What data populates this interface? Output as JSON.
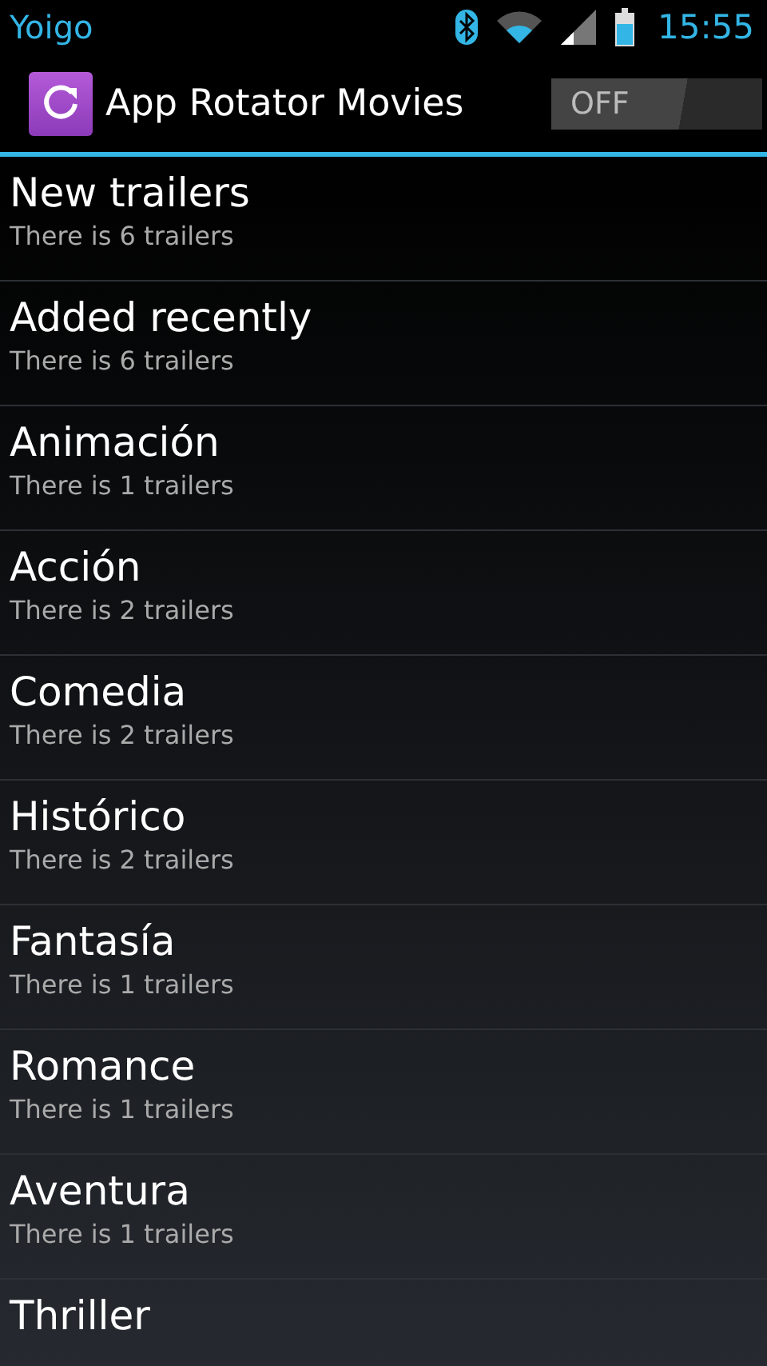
{
  "status_bar": {
    "carrier": "Yoigo",
    "time": "15:55"
  },
  "action_bar": {
    "title": "App Rotator Movies",
    "toggle": {
      "label": "OFF",
      "on": false
    }
  },
  "categories": [
    {
      "title": "New trailers",
      "subtitle": "There is 6 trailers"
    },
    {
      "title": "Added recently",
      "subtitle": "There is 6 trailers"
    },
    {
      "title": "Animación",
      "subtitle": "There is 1 trailers"
    },
    {
      "title": "Acción",
      "subtitle": "There is 2 trailers"
    },
    {
      "title": "Comedia",
      "subtitle": "There is 2 trailers"
    },
    {
      "title": "Histórico",
      "subtitle": "There is 2 trailers"
    },
    {
      "title": "Fantasía",
      "subtitle": "There is 1 trailers"
    },
    {
      "title": "Romance",
      "subtitle": "There is 1 trailers"
    },
    {
      "title": "Aventura",
      "subtitle": "There is 1 trailers"
    },
    {
      "title": "Thriller"
    }
  ]
}
